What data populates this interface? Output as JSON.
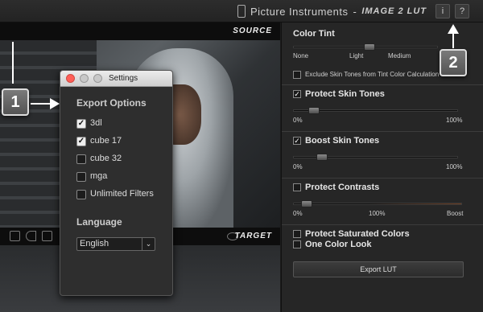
{
  "topbar": {
    "brand_name": "Picture Instruments",
    "brand_separator": "-",
    "brand_product": "IMAGE 2 LUT",
    "info_label": "i",
    "help_label": "?"
  },
  "viewer": {
    "source_label": "SOURCE",
    "target_label": "TARGET"
  },
  "panel": {
    "color_tint": {
      "title": "Color Tint",
      "labels": [
        "None",
        "Light",
        "Medium"
      ],
      "value_fraction": 0.33
    },
    "exclude_skin": {
      "label": "Exclude Skin Tones from Tint Color Calculation",
      "checked": false
    },
    "protect_skin": {
      "label": "Protect Skin Tones",
      "checked": true,
      "min": "0%",
      "max": "100%",
      "value_fraction": 0.1
    },
    "boost_skin": {
      "label": "Boost Skin Tones",
      "checked": true,
      "min": "0%",
      "max": "100%",
      "value_fraction": 0.15
    },
    "protect_contrasts": {
      "label": "Protect Contrasts",
      "checked": false,
      "min": "0%",
      "mid": "100%",
      "max": "Boost",
      "value_fraction": 0.05
    },
    "protect_saturated": {
      "label": "Protect Saturated Colors",
      "checked": false
    },
    "one_color": {
      "label": "One Color Look",
      "checked": false
    },
    "export_button": "Export LUT"
  },
  "settings_dialog": {
    "title": "Settings",
    "export_heading": "Export Options",
    "options": [
      {
        "label": "3dl",
        "checked": true
      },
      {
        "label": "cube 17",
        "checked": true
      },
      {
        "label": "cube 32",
        "checked": false
      },
      {
        "label": "mga",
        "checked": false
      },
      {
        "label": "Unlimited Filters",
        "checked": false
      }
    ],
    "language_heading": "Language",
    "language_value": "English",
    "checkmark": "✓"
  },
  "callouts": [
    "1",
    "2"
  ],
  "colors": {
    "accent_red": "#ff5f57",
    "callout_gray": "#666666",
    "panel_bg": "#262626"
  }
}
